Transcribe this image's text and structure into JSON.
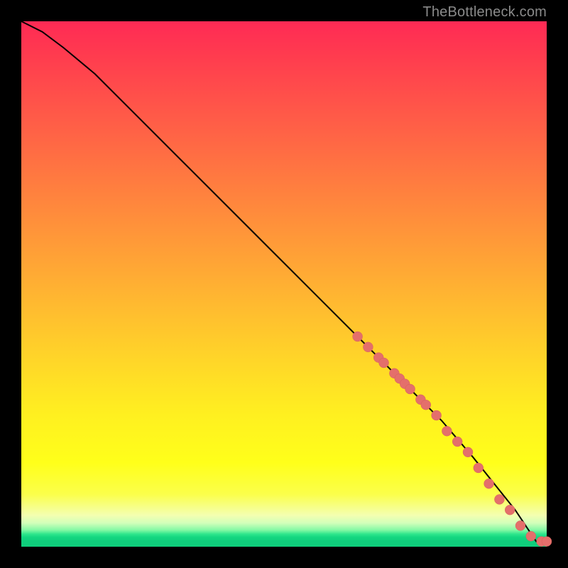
{
  "attribution": "TheBottleneck.com",
  "chart_data": {
    "type": "line",
    "title": "",
    "xlabel": "",
    "ylabel": "",
    "xlim": [
      0,
      100
    ],
    "ylim": [
      0,
      100
    ],
    "background_gradient": {
      "top": "#ff2a55",
      "mid": "#ffff1a",
      "bottom": "#0fce7c"
    },
    "series": [
      {
        "name": "bottleneck-curve",
        "type": "line",
        "x": [
          0,
          4,
          8,
          14,
          22,
          32,
          44,
          56,
          66,
          74,
          80,
          86,
          90,
          94,
          96,
          98,
          100
        ],
        "y": [
          100,
          98,
          95,
          90,
          82,
          72,
          60,
          48,
          38,
          30,
          24,
          17,
          12,
          7,
          4,
          1,
          1
        ]
      },
      {
        "name": "highlight-dots",
        "type": "scatter",
        "x": [
          64,
          66,
          68,
          69,
          71,
          72,
          73,
          74,
          76,
          77,
          79,
          81,
          83,
          85,
          87,
          89,
          91,
          93,
          95,
          97,
          99,
          100
        ],
        "y": [
          40,
          38,
          36,
          35,
          33,
          32,
          31,
          30,
          28,
          27,
          25,
          22,
          20,
          18,
          15,
          12,
          9,
          7,
          4,
          2,
          1,
          1
        ]
      }
    ],
    "description": "Monotonically decreasing curve from top-left (100%) to bottom-right (near 0%). Highlighted scatter points cluster on the lower-right third of the curve, ending in a small flat tail at the very bottom-right corner where the background is green."
  }
}
